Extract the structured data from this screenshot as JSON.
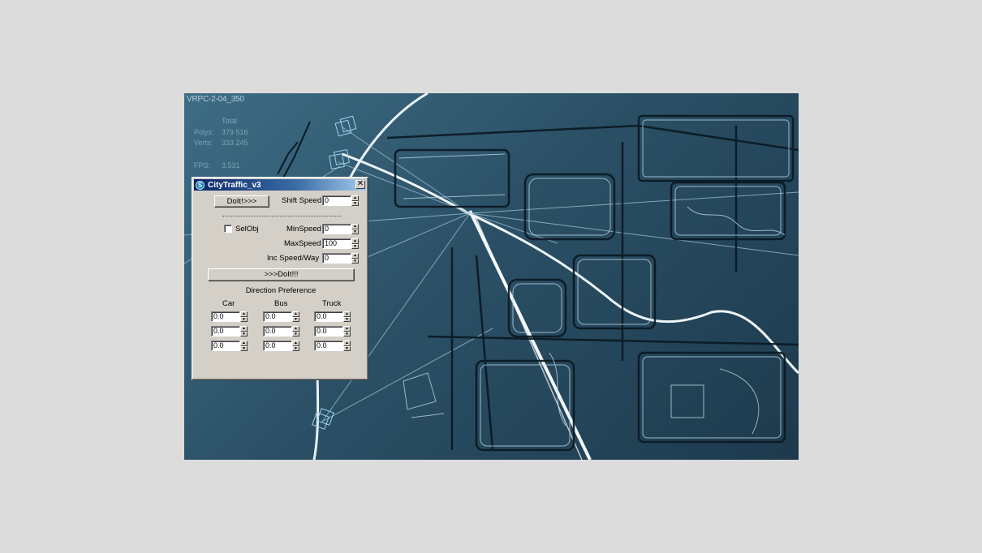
{
  "viewport": {
    "label": "VRPC-2-04_350",
    "stats": {
      "total_header": "Total",
      "polys_label": "Polys:",
      "polys_value": "379 516",
      "verts_label": "Verts:",
      "verts_value": "333 245",
      "fps_label": "FPS:",
      "fps_value": "3.531"
    }
  },
  "dialog": {
    "title": "CityTraffic_v3",
    "icon": "app-s-icon",
    "close_label": "✕",
    "doit_label": "DoIt!>>>",
    "shift_speed_label": "Shift Speed",
    "shift_speed_value": "0",
    "selobj_label": "SelObj",
    "min_speed_label": "MinSpeed",
    "min_speed_value": "0",
    "max_speed_label": "MaxSpeed",
    "max_speed_value": "100",
    "inc_speed_label": "Inc Speed/Way",
    "inc_speed_value": "0",
    "doit2_label": ">>>DoIt!!!",
    "direction_label": "Direction Preference",
    "columns": [
      "Car",
      "Bus",
      "Truck"
    ],
    "rows": [
      [
        "0.0",
        "0.0",
        "0.0"
      ],
      [
        "0.0",
        "0.0",
        "0.0"
      ],
      [
        "0.0",
        "0.0",
        "0.0"
      ]
    ]
  }
}
